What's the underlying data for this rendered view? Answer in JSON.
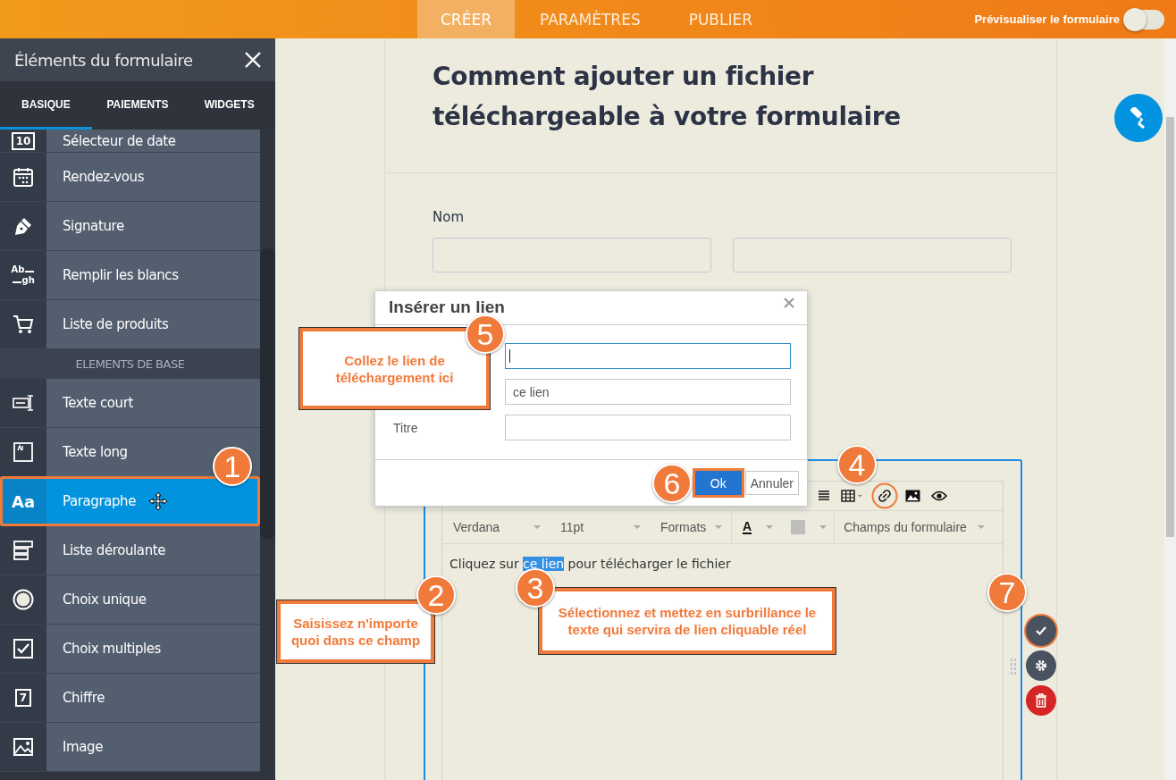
{
  "topbar": {
    "tabs": [
      {
        "label": "CRÉER",
        "selected": true
      },
      {
        "label": "PARAMÈTRES",
        "selected": false
      },
      {
        "label": "PUBLIER",
        "selected": false
      }
    ],
    "preview": {
      "label": "Prévisualiser le formulaire",
      "on": false
    }
  },
  "sidebar": {
    "title": "Éléments du formulaire",
    "tabs": [
      {
        "label": "BASIQUE",
        "selected": true
      },
      {
        "label": "PAIEMENTS",
        "selected": false
      },
      {
        "label": "WIDGETS",
        "selected": false
      }
    ],
    "items": [
      {
        "kind": "date",
        "icon_text": [
          "10"
        ],
        "label": "Sélecteur de date",
        "selected": false
      },
      {
        "kind": "calendar",
        "label": "Rendez-vous",
        "selected": false
      },
      {
        "kind": "pen",
        "label": "Signature",
        "selected": false
      },
      {
        "kind": "fill",
        "icon_text": [
          "Ab",
          "gh"
        ],
        "label": "Remplir les blancs",
        "selected": false
      },
      {
        "kind": "cart",
        "label": "Liste de produits",
        "selected": false
      },
      {
        "kind": "section",
        "label": "ELEMENTS DE BASE"
      },
      {
        "kind": "short",
        "label": "Texte court",
        "selected": false
      },
      {
        "kind": "long",
        "label": "Texte long",
        "selected": false
      },
      {
        "kind": "para",
        "icon_text": [
          "Aa"
        ],
        "label": "Paragraphe",
        "selected": true
      },
      {
        "kind": "dropdown",
        "label": "Liste déroulante",
        "selected": false
      },
      {
        "kind": "radio",
        "label": "Choix unique",
        "selected": false
      },
      {
        "kind": "check",
        "label": "Choix multiples",
        "selected": false
      },
      {
        "kind": "number",
        "icon_text": [
          "7"
        ],
        "label": "Chiffre",
        "selected": false
      },
      {
        "kind": "image",
        "label": "Image",
        "selected": false
      }
    ]
  },
  "form": {
    "heading": "Comment ajouter un fichier téléchargeable à votre formulaire",
    "name_label": "Nom",
    "editor": {
      "toolbar": [
        {
          "kind": "dropdown",
          "label": "Verdana"
        },
        {
          "kind": "dropdown",
          "label": "11pt"
        },
        {
          "kind": "dropdown",
          "label": "Formats"
        },
        {
          "kind": "text-color",
          "label": "A"
        },
        {
          "kind": "fill-color"
        },
        {
          "kind": "dropdown",
          "label": "Champs du formulaire"
        }
      ],
      "content": [
        {
          "text": "Cliquez sur ",
          "highlighted": false
        },
        {
          "text": "ce lien",
          "highlighted": true
        },
        {
          "text": " pour télécharger le fichier",
          "highlighted": false
        }
      ]
    }
  },
  "dialog": {
    "title": "Insérer un lien",
    "fields": [
      {
        "focused": true
      },
      {
        "value": "ce lien",
        "focused": false
      },
      {
        "label": "Titre",
        "focused": false
      }
    ],
    "buttons": [
      {
        "label": "Ok",
        "kind": "primary"
      },
      {
        "label": "Annuler",
        "kind": "default"
      }
    ]
  },
  "annotations": {
    "badges": [
      "1",
      "2",
      "3",
      "4",
      "5",
      "6",
      "7"
    ],
    "callouts": [
      {
        "text": "Saisissez n'importe quoi dans ce champ"
      },
      {
        "text": "Sélectionnez et mettez en surbrillance le texte qui servira de lien cliquable réel"
      },
      {
        "text": "Collez le lien de téléchargement ici"
      }
    ]
  }
}
